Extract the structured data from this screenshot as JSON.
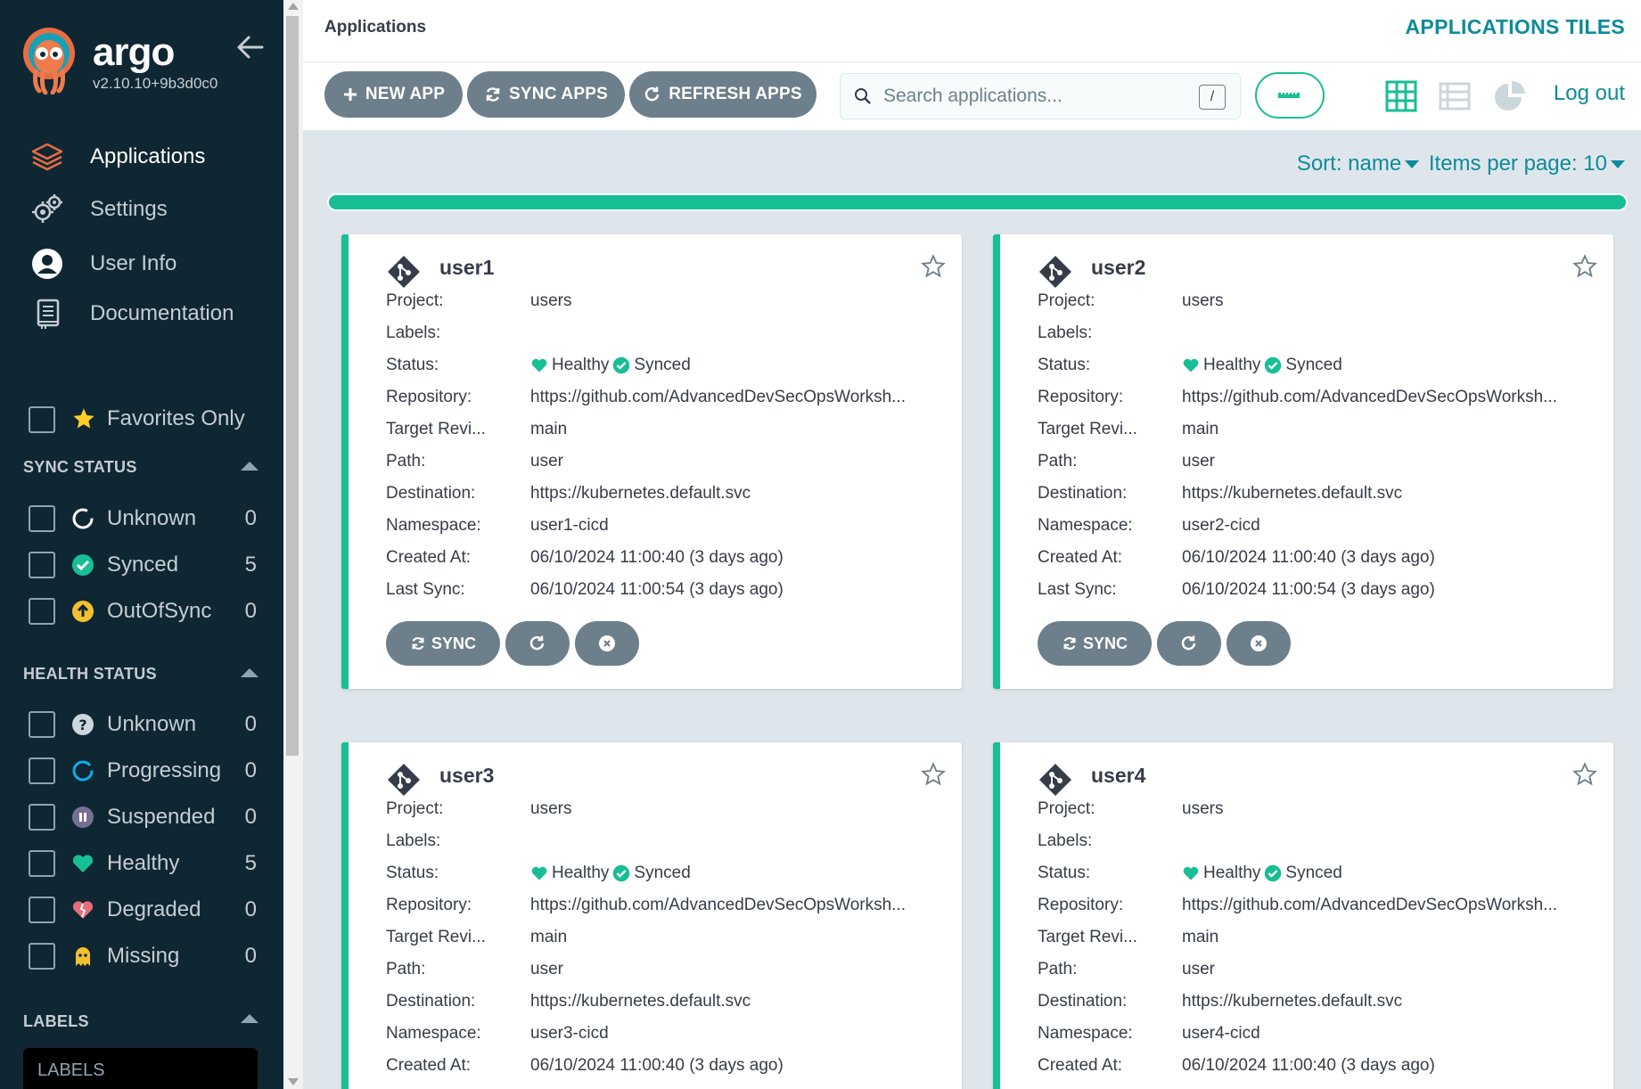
{
  "brand": {
    "name": "argo",
    "version": "v2.10.10+9b3d0c0"
  },
  "nav": [
    {
      "label": "Applications",
      "icon": "stack-icon"
    },
    {
      "label": "Settings",
      "icon": "gears-icon"
    },
    {
      "label": "User Info",
      "icon": "user-circle-icon"
    },
    {
      "label": "Documentation",
      "icon": "book-icon"
    }
  ],
  "favorites_label": "Favorites Only",
  "sync_status": {
    "title": "SYNC STATUS",
    "items": [
      {
        "label": "Unknown",
        "count": "0",
        "icon": "circle-notch-icon"
      },
      {
        "label": "Synced",
        "count": "5",
        "icon": "check-circle-icon"
      },
      {
        "label": "OutOfSync",
        "count": "0",
        "icon": "arrow-up-circle-icon"
      }
    ]
  },
  "health_status": {
    "title": "HEALTH STATUS",
    "items": [
      {
        "label": "Unknown",
        "count": "0",
        "icon": "question-circle-icon"
      },
      {
        "label": "Progressing",
        "count": "0",
        "icon": "spinner-icon"
      },
      {
        "label": "Suspended",
        "count": "0",
        "icon": "pause-circle-icon"
      },
      {
        "label": "Healthy",
        "count": "5",
        "icon": "heart-icon"
      },
      {
        "label": "Degraded",
        "count": "0",
        "icon": "heart-broken-icon"
      },
      {
        "label": "Missing",
        "count": "0",
        "icon": "ghost-icon"
      }
    ]
  },
  "labels_section": {
    "title": "LABELS",
    "placeholder": "LABELS"
  },
  "header": {
    "breadcrumb": "Applications",
    "view_title": "APPLICATIONS TILES"
  },
  "toolbar": {
    "new_app": "NEW APP",
    "sync_apps": "SYNC APPS",
    "refresh_apps": "REFRESH APPS",
    "search_placeholder": "Search applications...",
    "search_shortcut": "/",
    "logout": "Log out"
  },
  "sort": {
    "label": "Sort: name",
    "per_page": "Items per page: 10"
  },
  "progress_fraction": 1.0,
  "colors": {
    "accent": "#18be94",
    "link": "#0d8b9a",
    "sidebar": "#0f2733",
    "button": "#6d7f8b"
  },
  "field_labels": {
    "project": "Project:",
    "labels": "Labels:",
    "status": "Status:",
    "repository": "Repository:",
    "target_revision": "Target Revi...",
    "path": "Path:",
    "destination": "Destination:",
    "namespace": "Namespace:",
    "created_at": "Created At:",
    "last_sync": "Last Sync:"
  },
  "card_buttons": {
    "sync": "SYNC"
  },
  "apps": [
    {
      "name": "user1",
      "project": "users",
      "labels": "",
      "health": "Healthy",
      "sync": "Synced",
      "repository": "https://github.com/AdvancedDevSecOpsWorksh...",
      "target_revision": "main",
      "path": "user",
      "destination": "https://kubernetes.default.svc",
      "namespace": "user1-cicd",
      "created_at": "06/10/2024 11:00:40  (3 days ago)",
      "last_sync": "06/10/2024 11:00:54  (3 days ago)"
    },
    {
      "name": "user2",
      "project": "users",
      "labels": "",
      "health": "Healthy",
      "sync": "Synced",
      "repository": "https://github.com/AdvancedDevSecOpsWorksh...",
      "target_revision": "main",
      "path": "user",
      "destination": "https://kubernetes.default.svc",
      "namespace": "user2-cicd",
      "created_at": "06/10/2024 11:00:40  (3 days ago)",
      "last_sync": "06/10/2024 11:00:54  (3 days ago)"
    },
    {
      "name": "user3",
      "project": "users",
      "labels": "",
      "health": "Healthy",
      "sync": "Synced",
      "repository": "https://github.com/AdvancedDevSecOpsWorksh...",
      "target_revision": "main",
      "path": "user",
      "destination": "https://kubernetes.default.svc",
      "namespace": "user3-cicd",
      "created_at": "06/10/2024 11:00:40  (3 days ago)"
    },
    {
      "name": "user4",
      "project": "users",
      "labels": "",
      "health": "Healthy",
      "sync": "Synced",
      "repository": "https://github.com/AdvancedDevSecOpsWorksh...",
      "target_revision": "main",
      "path": "user",
      "destination": "https://kubernetes.default.svc",
      "namespace": "user4-cicd",
      "created_at": "06/10/2024 11:00:40  (3 days ago)"
    }
  ]
}
